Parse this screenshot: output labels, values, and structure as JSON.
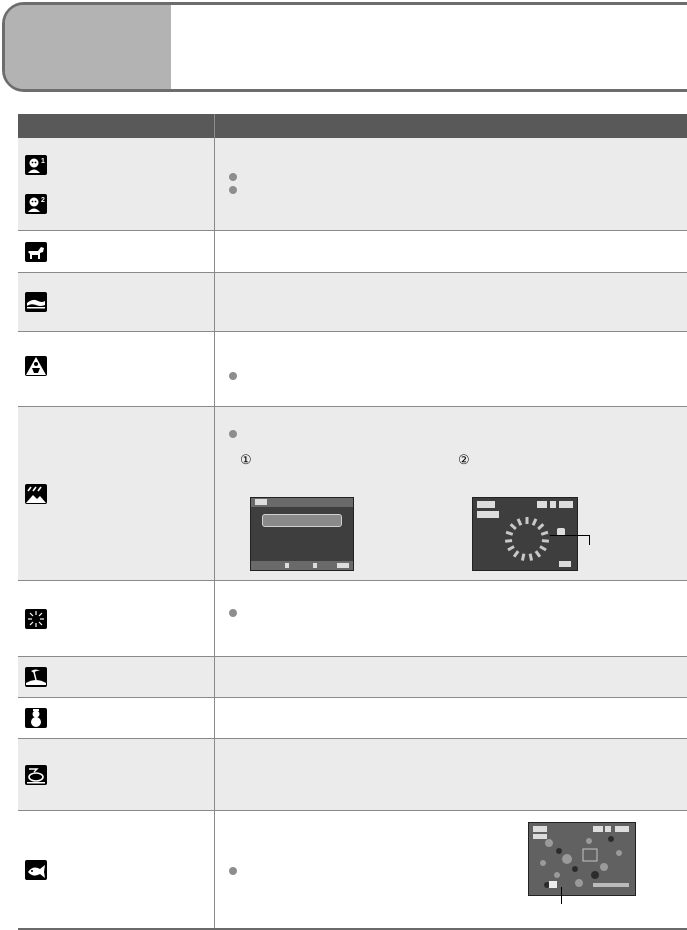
{
  "header": {
    "title": ""
  },
  "table": {
    "col1_header": "",
    "col2_header": ""
  },
  "rows": [
    {
      "icons": [
        "baby-1-icon",
        "baby-2-icon"
      ],
      "label": "",
      "bullets": 2
    },
    {
      "icons": [
        "pet-icon"
      ],
      "label": ""
    },
    {
      "icons": [
        "sunset-icon"
      ],
      "label": ""
    },
    {
      "icons": [
        "high-sensitivity-icon"
      ],
      "label": "",
      "bullets": 1
    },
    {
      "icons": [
        "starry-sky-icon"
      ],
      "label": "",
      "bullets": 1,
      "steps": [
        "①",
        "②"
      ]
    },
    {
      "icons": [
        "fireworks-icon"
      ],
      "label": "",
      "bullets": 1
    },
    {
      "icons": [
        "beach-icon"
      ],
      "label": ""
    },
    {
      "icons": [
        "snow-icon"
      ],
      "label": ""
    },
    {
      "icons": [
        "aerial-photo-icon"
      ],
      "label": ""
    },
    {
      "icons": [
        "underwater-icon"
      ],
      "label": "",
      "bullets": 1
    }
  ],
  "colors": {
    "header_tab": "#b3b3b3",
    "frame": "#6d6d6d",
    "table_header": "#595959",
    "row_shade": "#ebebeb",
    "bullet": "#8d8d8d"
  },
  "screens": {
    "starry_menu": {
      "status": ""
    },
    "starry_countdown": {
      "status": "OFF"
    },
    "underwater": {
      "status": ""
    }
  }
}
